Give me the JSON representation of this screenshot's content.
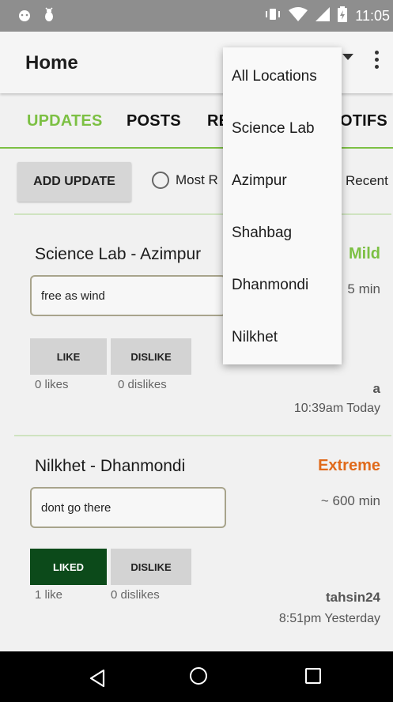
{
  "status": {
    "time": "11:05",
    "icons": [
      "android-icon",
      "debug-icon",
      "vibrate-icon",
      "wifi-icon",
      "signal-icon",
      "battery-icon"
    ]
  },
  "appbar": {
    "title": "Home"
  },
  "tabs": [
    {
      "label": "UPDATES",
      "active": true
    },
    {
      "label": "POSTS"
    },
    {
      "label": "RE"
    },
    {
      "label": "OTIFS"
    }
  ],
  "actions": {
    "add_label": "ADD UPDATE",
    "radio_most": "Most R",
    "radio_recent": "Recent"
  },
  "updates": [
    {
      "from": "Science Lab",
      "sep": " - ",
      "to": "Azimpur",
      "severity": "Mild",
      "severity_color": "#7cc043",
      "duration": "5 min",
      "comment": "free as wind",
      "like_label": "LIKE",
      "dislike_label": "DISLIKE",
      "likes": "0 likes",
      "dislikes": "0 dislikes",
      "author": "a",
      "time": "10:39am Today",
      "liked": false
    },
    {
      "from": "Nilkhet",
      "sep": " - ",
      "to": "Dhanmondi",
      "severity": "Extreme",
      "severity_color": "#e06a1b",
      "duration": "~ 600 min",
      "comment": "dont go there",
      "like_label": "LIKED",
      "dislike_label": "DISLIKE",
      "likes": "1 like",
      "dislikes": "0 dislikes",
      "author": "tahsin24",
      "time": "8:51pm Yesterday",
      "liked": true
    }
  ],
  "dropdown": {
    "items": [
      "All Locations",
      "Science Lab",
      "Azimpur",
      "Shahbag",
      "Dhanmondi",
      "Nilkhet"
    ]
  },
  "colors": {
    "accent": "#7cc043",
    "liked": "#0c4a1a"
  }
}
